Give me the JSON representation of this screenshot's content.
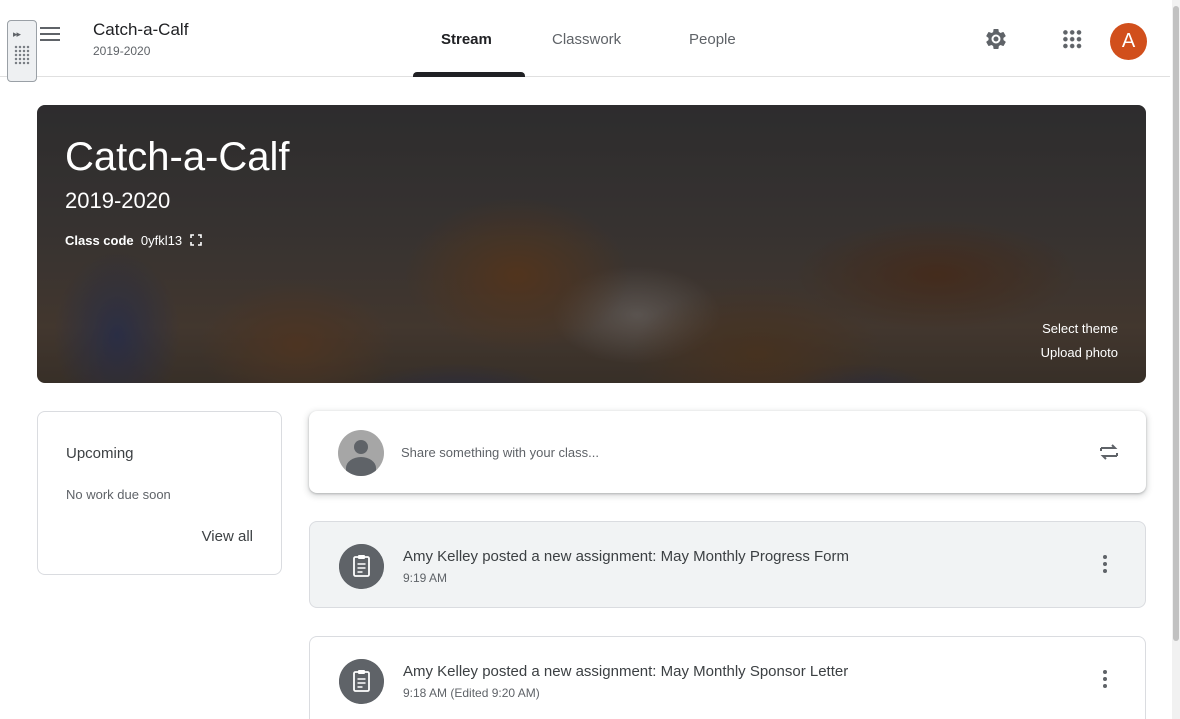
{
  "header": {
    "class_name": "Catch-a-Calf",
    "class_section": "2019-2020",
    "tabs": [
      {
        "label": "Stream",
        "active": true
      },
      {
        "label": "Classwork",
        "active": false
      },
      {
        "label": "People",
        "active": false
      }
    ],
    "avatar_letter": "A",
    "avatar_color": "#d14f1c",
    "icons": [
      "menu-icon",
      "settings-icon",
      "apps-grid-icon"
    ]
  },
  "banner": {
    "title": "Catch-a-Calf",
    "section": "2019-2020",
    "class_code_label": "Class code",
    "class_code": "0yfkl13",
    "select_theme": "Select theme",
    "upload_photo": "Upload photo"
  },
  "upcoming": {
    "heading": "Upcoming",
    "empty_text": "No work due soon",
    "view_all": "View all"
  },
  "share": {
    "placeholder": "Share something with your class..."
  },
  "posts": [
    {
      "title": "Amy Kelley posted a new assignment: May Monthly Progress Form",
      "time": "9:19 AM"
    },
    {
      "title": "Amy Kelley posted a new assignment: May Monthly Sponsor Letter",
      "time": "9:18 AM (Edited 9:20 AM)"
    }
  ]
}
